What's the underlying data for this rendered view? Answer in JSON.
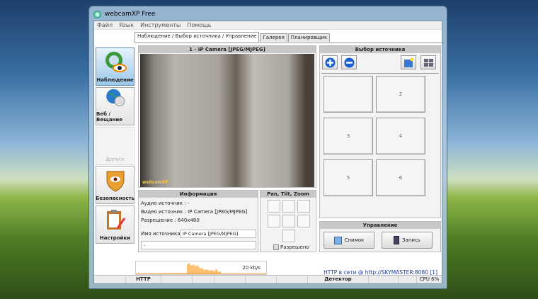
{
  "window": {
    "title": "webcamXP Free"
  },
  "menu": [
    "Файл",
    "Язык",
    "Инструменты",
    "Помощь"
  ],
  "tabs": [
    "Наблюдение / Выбор источника / Управление",
    "Галерея",
    "Планировщик"
  ],
  "sidebar": [
    {
      "label": "Наблюдение",
      "icon": "surveillance-eye-icon"
    },
    {
      "label": "Веб / Вещание",
      "icon": "globe-broadcast-icon"
    },
    {
      "label": "Допуск",
      "icon": ""
    },
    {
      "label": "Безопасность",
      "icon": "shield-eye-icon"
    },
    {
      "label": "Настройки",
      "icon": "clipboard-settings-icon"
    }
  ],
  "camera": {
    "header": "1 - IP Camera [JPEG/MJPEG]",
    "watermark": "webcamXP"
  },
  "info": {
    "header": "Информация",
    "audio": "Аудио источник : -",
    "video": "Видео источник : IP Camera [JPEG/MJPEG]",
    "resolution": "Разрешение : 640x480",
    "name_label": "Имя источника :",
    "name_value": "IP Camera [JPEG/MJPEG]",
    "extra_value": "-"
  },
  "ptz": {
    "header": "Pan, Tilt, Zoom",
    "enabled_label": "Разрешено"
  },
  "sources": {
    "header": "Выбор источника",
    "cells": [
      "2",
      "3",
      "4",
      "5",
      "6"
    ]
  },
  "control": {
    "header": "Управление",
    "snapshot": "Снимок",
    "record": "Запись"
  },
  "bandwidth": {
    "rate": "20 kb/s"
  },
  "http_link": "HTTP в сети @ http://SKYMASTER:8080 [1]",
  "status": {
    "http": "HTTP",
    "detector": "Детектор",
    "cpu": "CPU 6%"
  }
}
